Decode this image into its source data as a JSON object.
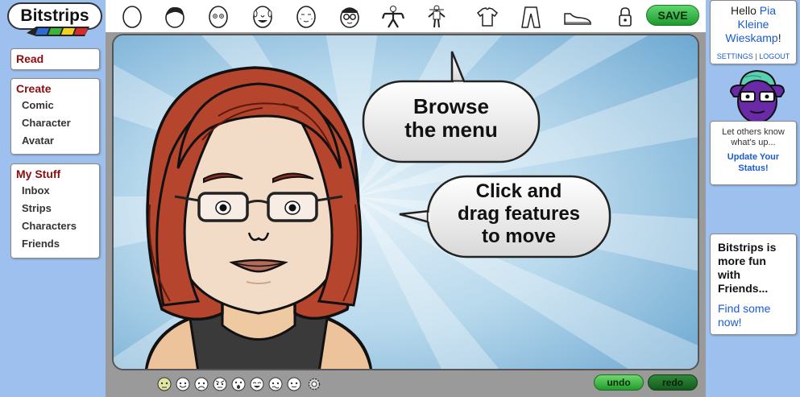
{
  "app": {
    "name": "Bitstrips"
  },
  "nav": {
    "read": {
      "label": "Read"
    },
    "create": {
      "label": "Create",
      "items": [
        "Comic",
        "Character",
        "Avatar"
      ]
    },
    "mystuff": {
      "label": "My Stuff",
      "items": [
        "Inbox",
        "Strips",
        "Characters",
        "Friends"
      ]
    }
  },
  "toolbar": {
    "tools": [
      "head-shape-icon",
      "hair-icon",
      "eyes-icon",
      "nose-mouth-icon",
      "face-details-icon",
      "glasses-icon",
      "body-icon",
      "body-size-icon",
      "shirt-icon",
      "pants-icon",
      "shoes-icon",
      "lock-icon"
    ],
    "save_label": "SAVE"
  },
  "stage": {
    "bubble1": [
      "Browse",
      "the menu"
    ],
    "bubble2": [
      "Click and",
      "drag features",
      "to move"
    ]
  },
  "bottom": {
    "undo_label": "undo",
    "redo_label": "redo",
    "expressions_count": 8
  },
  "user": {
    "greeting": "Hello",
    "name_line1": "Pia",
    "name_line2": "Kleine",
    "name_line3": "Wieskamp",
    "exclaim": "!",
    "settings": "SETTINGS",
    "sep": "|",
    "logout": "LOGOUT"
  },
  "status": {
    "prompt_line1": "Let others know",
    "prompt_line2": "what's up...",
    "link_line1": "Update Your",
    "link_line2": "Status!"
  },
  "friends_box": {
    "line1": "Bitstrips is",
    "line2": "more fun",
    "line3": "with",
    "line4": "Friends...",
    "link_line1": "Find some",
    "link_line2": "now!"
  },
  "colors": {
    "nav_heading": "#8b0e0e",
    "link": "#1a5ccc",
    "save_green": "#1e9a2e",
    "stage_sky": "#9ec8e6",
    "page_bg": "#9ec0ee"
  }
}
